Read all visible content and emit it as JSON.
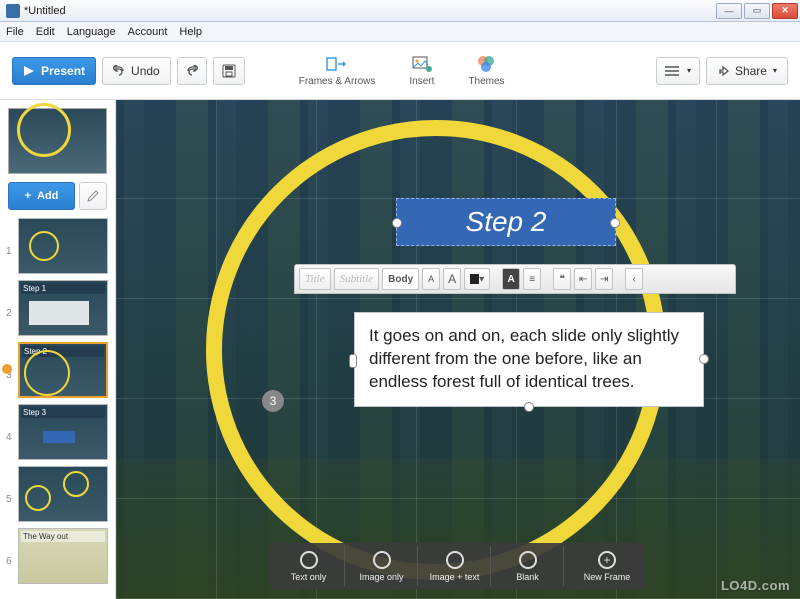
{
  "window": {
    "title": "*Untitled"
  },
  "menu": {
    "items": [
      "File",
      "Edit",
      "Language",
      "Account",
      "Help"
    ]
  },
  "toolbar": {
    "present": "Present",
    "undo": "Undo",
    "tools": [
      {
        "id": "frames-arrows",
        "label": "Frames & Arrows"
      },
      {
        "id": "insert",
        "label": "Insert"
      },
      {
        "id": "themes",
        "label": "Themes"
      }
    ],
    "share": "Share"
  },
  "sidebar": {
    "add": "Add",
    "thumbs": [
      {
        "n": "1",
        "caption": ""
      },
      {
        "n": "2",
        "caption": "Step 1"
      },
      {
        "n": "3",
        "caption": "Step 2"
      },
      {
        "n": "4",
        "caption": "Step 3"
      },
      {
        "n": "5",
        "caption": ""
      },
      {
        "n": "6",
        "caption": "The Way out"
      }
    ]
  },
  "canvas": {
    "title": "Step 2",
    "body": "It goes on and on, each slide only slightly different from the one before, like an endless forest full of identical trees.",
    "step_badge": "3",
    "editbar": {
      "styles": [
        "Title",
        "Subtitle",
        "Body"
      ],
      "buttons": {
        "font_dec": "A",
        "font_inc": "A",
        "bold": "A",
        "list": "≡",
        "quote": "❝",
        "indent_out": "⇤",
        "indent_in": "⇥",
        "more": "‹"
      }
    }
  },
  "bottombar": {
    "items": [
      {
        "id": "text-only",
        "label": "Text only"
      },
      {
        "id": "image-only",
        "label": "Image only"
      },
      {
        "id": "image-text",
        "label": "Image + text"
      },
      {
        "id": "blank",
        "label": "Blank"
      },
      {
        "id": "new-frame",
        "label": "New Frame"
      }
    ]
  },
  "watermark": "LO4D.com"
}
